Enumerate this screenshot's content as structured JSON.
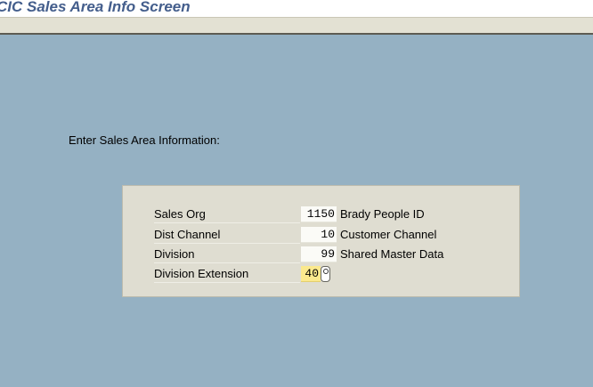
{
  "window": {
    "title": "CIC Sales Area Info Screen"
  },
  "main": {
    "prompt": "Enter Sales Area Information:"
  },
  "form": {
    "rows": [
      {
        "label": "Sales Org",
        "value": "1150",
        "description": "Brady People ID"
      },
      {
        "label": "Dist Channel",
        "value": "10",
        "description": "Customer Channel"
      },
      {
        "label": "Division",
        "value": "99",
        "description": "Shared Master Data"
      },
      {
        "label": "Division Extension",
        "value": "40",
        "description": ""
      }
    ],
    "f4_help_icon": "value-help-icon"
  },
  "colors": {
    "background": "#95b1c3",
    "panel": "#dfddd1",
    "title": "#445e8c",
    "required_field": "#fbe98d"
  }
}
